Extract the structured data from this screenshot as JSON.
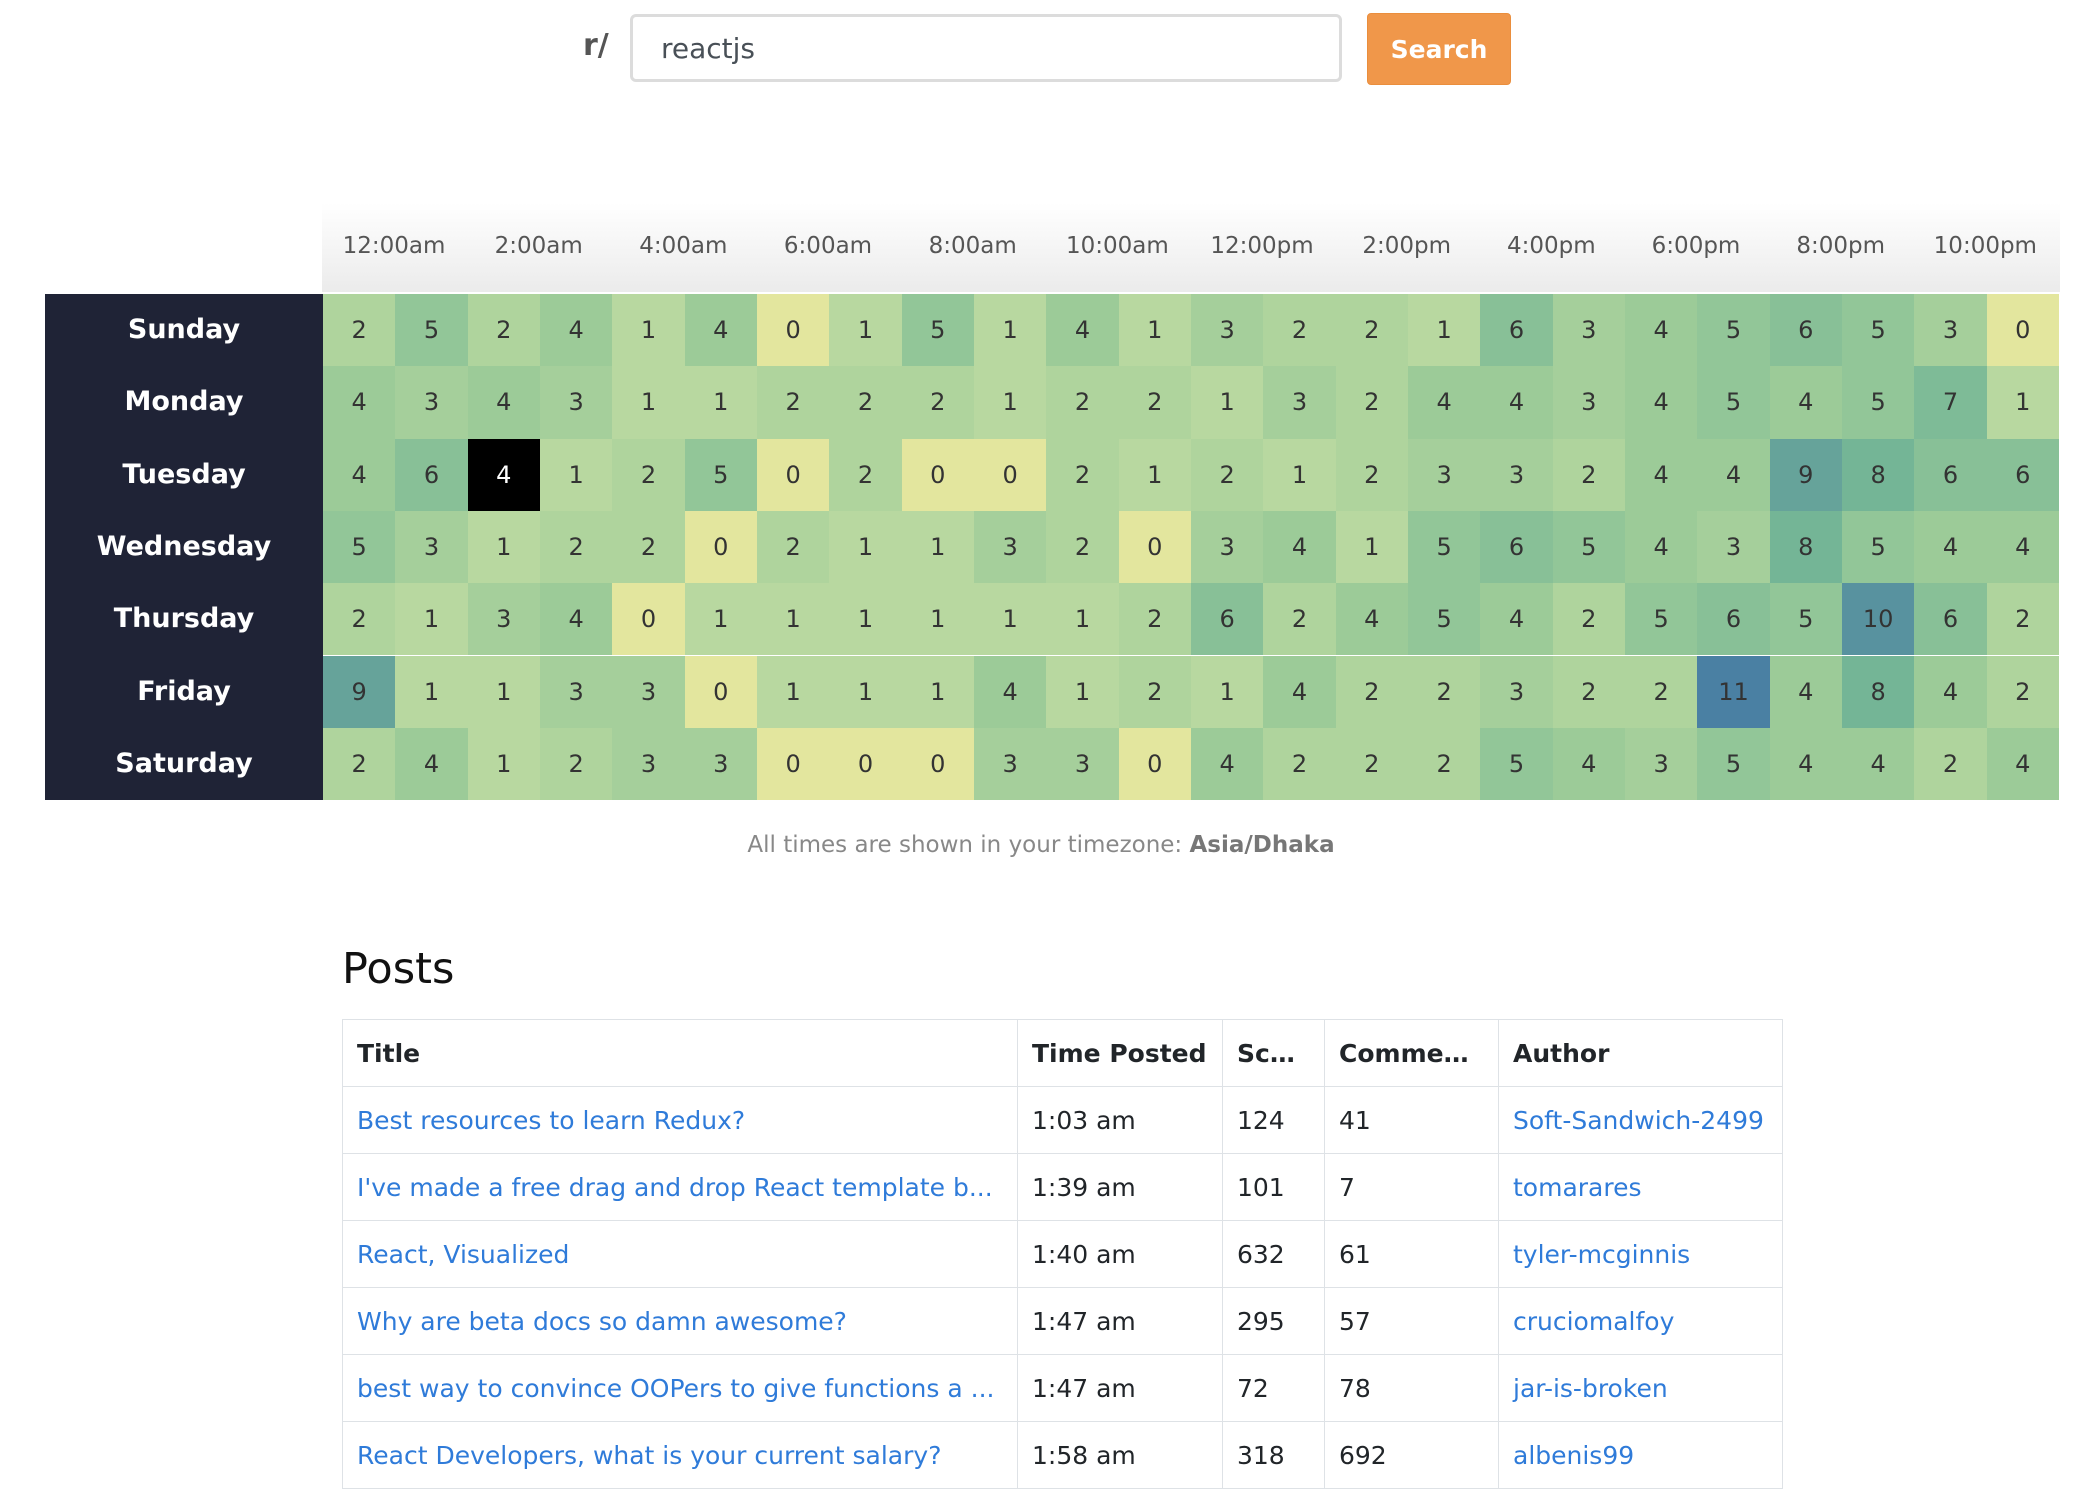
{
  "search": {
    "prefix": "r/",
    "value": "reactjs",
    "button_label": "Search"
  },
  "heatmap": {
    "hour_labels": [
      "12:00am",
      "2:00am",
      "4:00am",
      "6:00am",
      "8:00am",
      "10:00am",
      "12:00pm",
      "2:00pm",
      "4:00pm",
      "6:00pm",
      "8:00pm",
      "10:00pm"
    ],
    "days": [
      "Sunday",
      "Monday",
      "Tuesday",
      "Wednesday",
      "Thursday",
      "Friday",
      "Saturday"
    ],
    "values": [
      [
        2,
        5,
        2,
        4,
        1,
        4,
        0,
        1,
        5,
        1,
        4,
        1,
        3,
        2,
        2,
        1,
        6,
        3,
        4,
        5,
        6,
        5,
        3,
        0
      ],
      [
        4,
        3,
        4,
        3,
        1,
        1,
        2,
        2,
        2,
        1,
        2,
        2,
        1,
        3,
        2,
        4,
        4,
        3,
        4,
        5,
        4,
        5,
        7,
        1
      ],
      [
        4,
        6,
        4,
        1,
        2,
        5,
        0,
        2,
        0,
        0,
        2,
        1,
        2,
        1,
        2,
        3,
        3,
        2,
        4,
        4,
        9,
        8,
        6,
        6
      ],
      [
        5,
        3,
        1,
        2,
        2,
        0,
        2,
        1,
        1,
        3,
        2,
        0,
        3,
        4,
        1,
        5,
        6,
        5,
        4,
        3,
        8,
        5,
        4,
        4
      ],
      [
        2,
        1,
        3,
        4,
        0,
        1,
        1,
        1,
        1,
        1,
        1,
        2,
        6,
        2,
        4,
        5,
        4,
        2,
        5,
        6,
        5,
        10,
        6,
        2
      ],
      [
        9,
        1,
        1,
        3,
        3,
        0,
        1,
        1,
        1,
        4,
        1,
        2,
        1,
        4,
        2,
        2,
        3,
        2,
        2,
        11,
        4,
        8,
        4,
        2
      ],
      [
        2,
        4,
        1,
        2,
        3,
        3,
        0,
        0,
        0,
        3,
        3,
        0,
        4,
        2,
        2,
        2,
        5,
        4,
        3,
        5,
        4,
        4,
        2,
        4
      ]
    ],
    "selected_cell": {
      "day": "Tuesday",
      "hour": "2:00am"
    },
    "colors": {
      "zero": "#e3e69e",
      "low": "#b8d8a0",
      "mid": "#74b596",
      "high": "#4a80a3",
      "selected": "#000000"
    }
  },
  "timezone": {
    "prefix": "All times are shown in your timezone: ",
    "zone": "Asia/Dhaka"
  },
  "posts": {
    "title": "Posts",
    "columns": [
      "Title",
      "Time Posted",
      "Score",
      "Comments",
      "Author"
    ],
    "rows": [
      {
        "title": "Best resources to learn Redux?",
        "time": "1:03 am",
        "score": "124",
        "comments": "41",
        "author": "Soft-Sandwich-2499"
      },
      {
        "title": "I've made a free drag and drop React template b...",
        "time": "1:39 am",
        "score": "101",
        "comments": "7",
        "author": "tomarares"
      },
      {
        "title": "React, Visualized",
        "time": "1:40 am",
        "score": "632",
        "comments": "61",
        "author": "tyler-mcginnis"
      },
      {
        "title": "Why are beta docs so damn awesome?",
        "time": "1:47 am",
        "score": "295",
        "comments": "57",
        "author": "cruciomalfoy"
      },
      {
        "title": "best way to convince OOPers to give functions a ...",
        "time": "1:47 am",
        "score": "72",
        "comments": "78",
        "author": "jar-is-broken"
      },
      {
        "title": "React Developers, what is your current salary?",
        "time": "1:58 am",
        "score": "318",
        "comments": "692",
        "author": "albenis99"
      }
    ]
  }
}
